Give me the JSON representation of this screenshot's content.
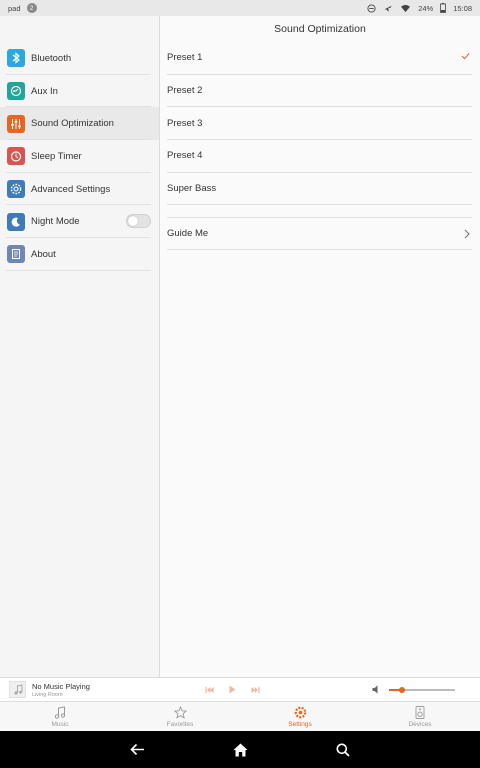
{
  "status": {
    "carrier": "pad",
    "notification_count": "2",
    "battery": "24%",
    "time": "15:08"
  },
  "sidebar": {
    "items": [
      {
        "label": "Bluetooth",
        "icon": "bluetooth-icon",
        "color": "#2aa9e0"
      },
      {
        "label": "Aux In",
        "icon": "aux-in-icon",
        "color": "#1fa89a"
      },
      {
        "label": "Sound Optimization",
        "icon": "equalizer-icon",
        "color": "#e8641f"
      },
      {
        "label": "Sleep Timer",
        "icon": "timer-icon",
        "color": "#d9534f"
      },
      {
        "label": "Advanced Settings",
        "icon": "gear-icon",
        "color": "#3d7cb8"
      },
      {
        "label": "Night Mode",
        "icon": "moon-icon",
        "color": "#3d7cb8"
      },
      {
        "label": "About",
        "icon": "document-icon",
        "color": "#6f86b8"
      }
    ]
  },
  "main": {
    "title": "Sound Optimization",
    "presets": [
      "Preset 1",
      "Preset 2",
      "Preset 3",
      "Preset 4",
      "Super Bass"
    ],
    "guide": "Guide Me"
  },
  "player": {
    "title": "No Music Playing",
    "subtitle": "Living Room",
    "volume_level": 0.2
  },
  "tabs": [
    {
      "label": "Music",
      "icon": "music-note-icon"
    },
    {
      "label": "Favorites",
      "icon": "star-icon"
    },
    {
      "label": "Settings",
      "icon": "settings-gear-icon"
    },
    {
      "label": "Devices",
      "icon": "speaker-icon"
    }
  ],
  "colors": {
    "accent": "#e8641f",
    "navbar": "#000000"
  }
}
